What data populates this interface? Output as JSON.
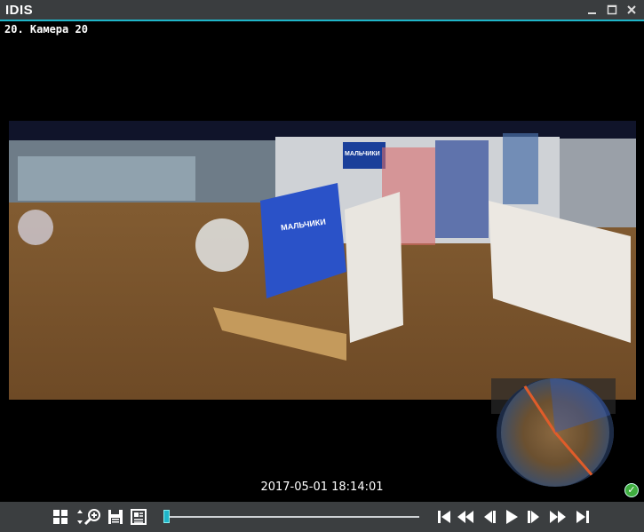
{
  "app": {
    "title": "IDIS"
  },
  "window_controls": {
    "minimize_icon": "minimize-icon",
    "maximize_icon": "maximize-icon",
    "close_icon": "close-icon"
  },
  "camera": {
    "label": "20. Камера 20",
    "timestamp": "2017-05-01 18:14:01"
  },
  "scene_signs": {
    "sign1": "МАЛЬЧИКИ",
    "sign2": "МАЛЬЧИКИ"
  },
  "toolbar": {
    "layout_icon": "grid-layout-icon",
    "zoom_icon": "zoom-in-icon",
    "save_icon": "save-icon",
    "report_icon": "report-icon",
    "first_icon": "skip-to-start-icon",
    "rewind_icon": "fast-rewind-icon",
    "step_back_icon": "step-back-icon",
    "play_icon": "play-icon",
    "step_fwd_icon": "step-forward-icon",
    "fast_fwd_icon": "fast-forward-icon",
    "last_icon": "skip-to-end-icon"
  },
  "colors": {
    "accent": "#1fb5c9",
    "titlebar": "#3a3d3f",
    "status_ok": "#3fae3f"
  }
}
